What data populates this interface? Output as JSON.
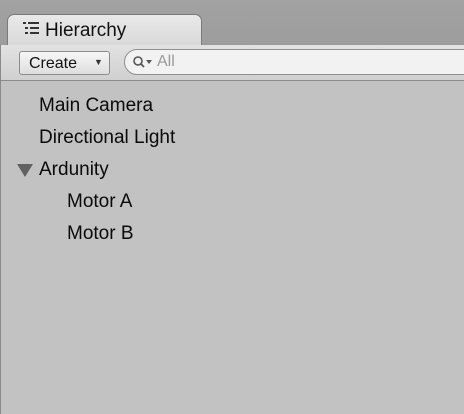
{
  "panel": {
    "tab_title": "Hierarchy",
    "tab_icon": "list-icon"
  },
  "toolbar": {
    "create_label": "Create",
    "create_dropdown_icon": "dropdown-arrow-icon",
    "search_icon": "search-icon",
    "search_placeholder": "All"
  },
  "hierarchy": {
    "items": [
      {
        "label": "Main Camera",
        "depth": 0,
        "expandable": false
      },
      {
        "label": "Directional Light",
        "depth": 0,
        "expandable": false
      },
      {
        "label": "Ardunity",
        "depth": 0,
        "expandable": true,
        "expanded": true
      },
      {
        "label": "Motor A",
        "depth": 1,
        "expandable": false
      },
      {
        "label": "Motor B",
        "depth": 1,
        "expandable": false
      }
    ]
  }
}
